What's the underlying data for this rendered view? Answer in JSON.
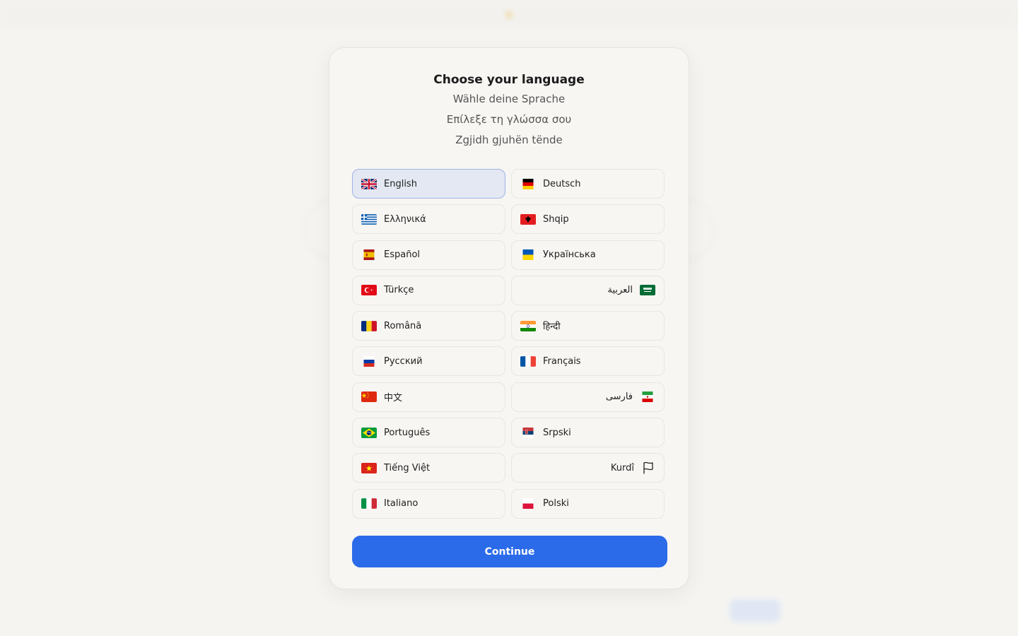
{
  "modal": {
    "title": "Choose your language",
    "subtitles": [
      "Wähle deine Sprache",
      "Επίλεξε τη γλώσσα σου",
      "Zgjidh gjuhën tënde"
    ],
    "continue_label": "Continue",
    "selected": "English"
  },
  "languages": [
    {
      "label": "English",
      "flag": "flag-gb-icon"
    },
    {
      "label": "Deutsch",
      "flag": "flag-de-icon"
    },
    {
      "label": "Ελληνικά",
      "flag": "flag-gr-icon"
    },
    {
      "label": "Shqip",
      "flag": "flag-al-icon"
    },
    {
      "label": "Español",
      "flag": "flag-es-icon"
    },
    {
      "label": "Українська",
      "flag": "flag-ua-icon"
    },
    {
      "label": "Türkçe",
      "flag": "flag-tr-icon"
    },
    {
      "label": "العربية",
      "flag": "flag-sa-icon"
    },
    {
      "label": "Română",
      "flag": "flag-ro-icon"
    },
    {
      "label": "हिन्दी",
      "flag": "flag-in-icon"
    },
    {
      "label": "Русский",
      "flag": "flag-ru-icon"
    },
    {
      "label": "Français",
      "flag": "flag-fr-icon"
    },
    {
      "label": "中文",
      "flag": "flag-cn-icon"
    },
    {
      "label": "فارسی",
      "flag": "flag-ir-icon"
    },
    {
      "label": "Português",
      "flag": "flag-br-icon"
    },
    {
      "label": "Srpski",
      "flag": "flag-rs-icon"
    },
    {
      "label": "Tiếng Việt",
      "flag": "flag-vn-icon"
    },
    {
      "label": "Kurdî",
      "flag": "flag-outline-icon"
    },
    {
      "label": "Italiano",
      "flag": "flag-it-icon"
    },
    {
      "label": "Polski",
      "flag": "flag-pl-icon"
    }
  ],
  "colors": {
    "accent": "#2b6bea",
    "selected_bg": "#e3e8f2",
    "selected_border": "#9fb3e6",
    "modal_bg": "#f7f6f3"
  }
}
